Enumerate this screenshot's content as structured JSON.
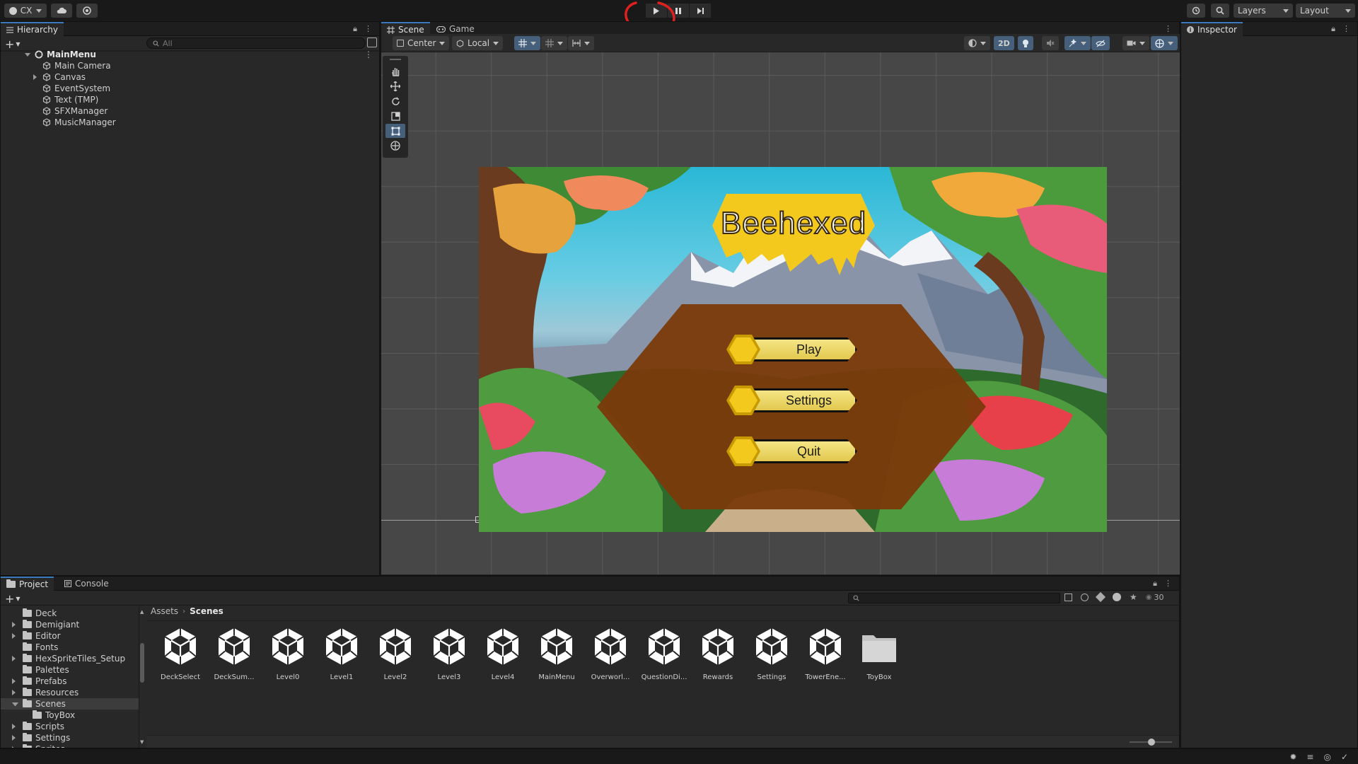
{
  "toolbar": {
    "account": "CX",
    "layers": "Layers",
    "layout": "Layout"
  },
  "hierarchy": {
    "tab": "Hierarchy",
    "search_placeholder": "All",
    "scene": "MainMenu",
    "items": [
      {
        "label": "Main Camera",
        "expandable": false
      },
      {
        "label": "Canvas",
        "expandable": true
      },
      {
        "label": "EventSystem",
        "expandable": false
      },
      {
        "label": "Text (TMP)",
        "expandable": false
      },
      {
        "label": "SFXManager",
        "expandable": false
      },
      {
        "label": "MusicManager",
        "expandable": false
      }
    ]
  },
  "scene_tabs": {
    "scene": "Scene",
    "game": "Game"
  },
  "scene_toolbar": {
    "pivot": "Center",
    "space": "Local",
    "mode_2d": "2D"
  },
  "game": {
    "title": "Beehexed",
    "buttons": [
      "Play",
      "Settings",
      "Quit"
    ]
  },
  "inspector": {
    "tab": "Inspector"
  },
  "project": {
    "tabs": {
      "project": "Project",
      "console": "Console"
    },
    "breadcrumb": [
      "Assets",
      "Scenes"
    ],
    "hidden_count": "30",
    "folders": [
      {
        "label": "Deck",
        "expandable": false,
        "indent": 0
      },
      {
        "label": "Demigiant",
        "expandable": true,
        "indent": 0
      },
      {
        "label": "Editor",
        "expandable": true,
        "indent": 0
      },
      {
        "label": "Fonts",
        "expandable": false,
        "indent": 0
      },
      {
        "label": "HexSpriteTiles_Setup",
        "expandable": true,
        "indent": 0
      },
      {
        "label": "Palettes",
        "expandable": false,
        "indent": 0
      },
      {
        "label": "Prefabs",
        "expandable": true,
        "indent": 0
      },
      {
        "label": "Resources",
        "expandable": true,
        "indent": 0
      },
      {
        "label": "Scenes",
        "expandable": true,
        "indent": 0,
        "selected": true,
        "open": true
      },
      {
        "label": "ToyBox",
        "expandable": false,
        "indent": 1
      },
      {
        "label": "Scripts",
        "expandable": true,
        "indent": 0
      },
      {
        "label": "Settings",
        "expandable": true,
        "indent": 0
      },
      {
        "label": "Sprites",
        "expandable": true,
        "indent": 0
      }
    ],
    "assets": [
      {
        "label": "DeckSelect",
        "kind": "scene"
      },
      {
        "label": "DeckSum...",
        "kind": "scene"
      },
      {
        "label": "Level0",
        "kind": "scene"
      },
      {
        "label": "Level1",
        "kind": "scene"
      },
      {
        "label": "Level2",
        "kind": "scene"
      },
      {
        "label": "Level3",
        "kind": "scene"
      },
      {
        "label": "Level4",
        "kind": "scene"
      },
      {
        "label": "MainMenu",
        "kind": "scene"
      },
      {
        "label": "Overworl...",
        "kind": "scene"
      },
      {
        "label": "QuestionDi...",
        "kind": "scene"
      },
      {
        "label": "Rewards",
        "kind": "scene"
      },
      {
        "label": "Settings",
        "kind": "scene"
      },
      {
        "label": "TowerEne...",
        "kind": "scene"
      },
      {
        "label": "ToyBox",
        "kind": "folder"
      }
    ]
  },
  "colors": {
    "accent": "#3a79bb",
    "annotation": "#e02020",
    "honey": "#f2c91c"
  }
}
